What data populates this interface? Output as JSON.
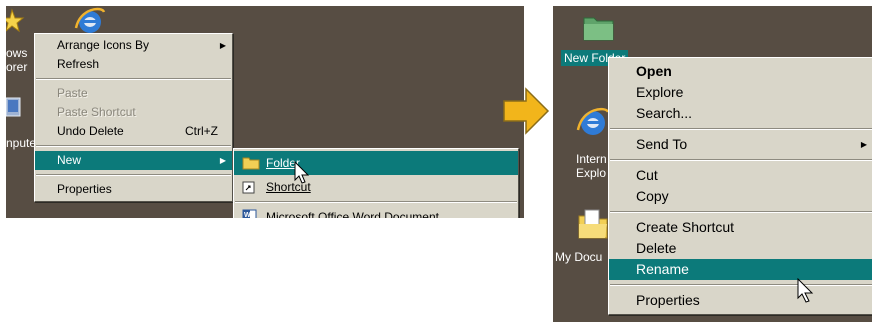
{
  "left_desktop": {
    "icon_labels": [
      "ows",
      "orer",
      "nputer"
    ],
    "context_menu": {
      "arrange_icons_by": "Arrange Icons By",
      "refresh": "Refresh",
      "paste": "Paste",
      "paste_shortcut": "Paste Shortcut",
      "undo_delete": "Undo Delete",
      "undo_delete_shortcut": "Ctrl+Z",
      "new": "New",
      "properties": "Properties"
    },
    "new_submenu": {
      "folder": "Folder",
      "shortcut": "Shortcut",
      "word_document": "Microsoft Office Word Document"
    }
  },
  "right_desktop": {
    "new_folder_label": "New Folder",
    "ie_label_line1": "Intern",
    "ie_label_line2": "Explo",
    "mydocs_label": "My Docu",
    "context_menu": {
      "open": "Open",
      "explore": "Explore",
      "search": "Search...",
      "send_to": "Send To",
      "cut": "Cut",
      "copy": "Copy",
      "create_shortcut": "Create Shortcut",
      "delete": "Delete",
      "rename": "Rename",
      "properties": "Properties"
    }
  },
  "colors": {
    "desktop": "#574d43",
    "menu": "#d9d6c9",
    "highlight": "#0c7a7a",
    "arrow": "#f2b51b"
  },
  "icons": [
    "star-icon",
    "internet-explorer-icon",
    "computer-icon",
    "folder-icon",
    "shortcut-icon",
    "word-document-icon",
    "arrow-right-icon",
    "mouse-cursor-icon",
    "my-documents-icon"
  ]
}
